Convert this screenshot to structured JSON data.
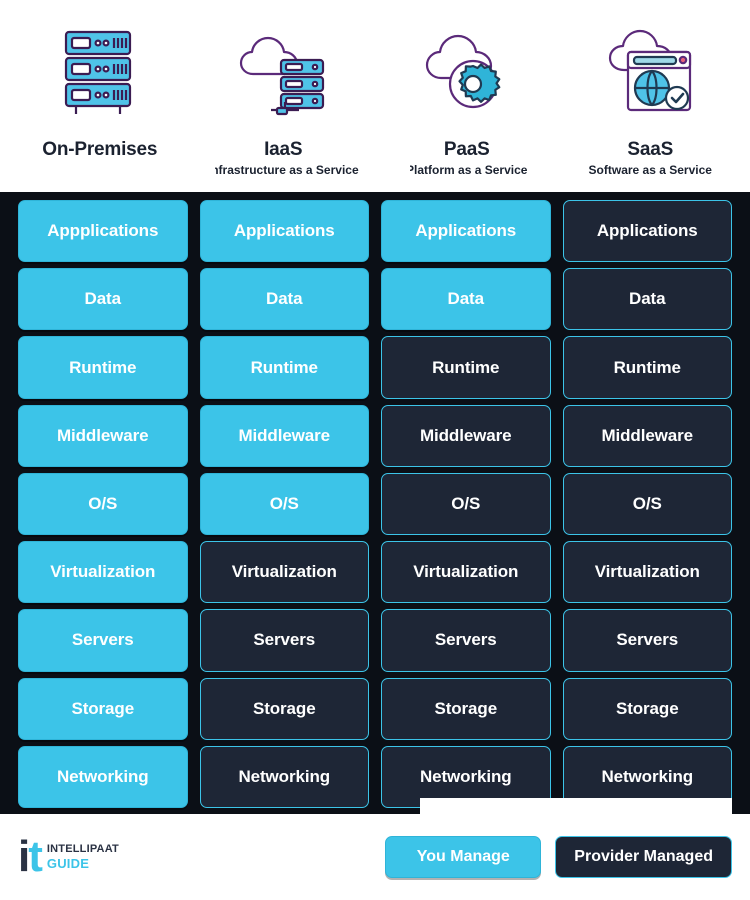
{
  "columns": [
    {
      "id": "on-premises",
      "title": "On-Premises",
      "subtitle": "",
      "icon": "server-rack-icon"
    },
    {
      "id": "iaas",
      "title": "IaaS",
      "subtitle": "Infrastructure as a Service",
      "icon": "cloud-server-icon"
    },
    {
      "id": "paas",
      "title": "PaaS",
      "subtitle": "Platform as a Service",
      "icon": "cloud-gear-icon"
    },
    {
      "id": "saas",
      "title": "SaaS",
      "subtitle": "Software as a Service",
      "icon": "cloud-browser-globe-icon"
    }
  ],
  "rows": [
    "Applications",
    "Data",
    "Runtime",
    "Middleware",
    "O/S",
    "Virtualization",
    "Servers",
    "Storage",
    "Networking"
  ],
  "cells": [
    [
      {
        "label": "Appplications",
        "managed": "you"
      },
      {
        "label": "Applications",
        "managed": "you"
      },
      {
        "label": "Applications",
        "managed": "you"
      },
      {
        "label": "Applications",
        "managed": "provider"
      }
    ],
    [
      {
        "label": "Data",
        "managed": "you"
      },
      {
        "label": "Data",
        "managed": "you"
      },
      {
        "label": "Data",
        "managed": "you"
      },
      {
        "label": "Data",
        "managed": "provider"
      }
    ],
    [
      {
        "label": "Runtime",
        "managed": "you"
      },
      {
        "label": "Runtime",
        "managed": "you"
      },
      {
        "label": "Runtime",
        "managed": "provider"
      },
      {
        "label": "Runtime",
        "managed": "provider"
      }
    ],
    [
      {
        "label": "Middleware",
        "managed": "you"
      },
      {
        "label": "Middleware",
        "managed": "you"
      },
      {
        "label": "Middleware",
        "managed": "provider"
      },
      {
        "label": "Middleware",
        "managed": "provider"
      }
    ],
    [
      {
        "label": "O/S",
        "managed": "you"
      },
      {
        "label": "O/S",
        "managed": "you"
      },
      {
        "label": "O/S",
        "managed": "provider"
      },
      {
        "label": "O/S",
        "managed": "provider"
      }
    ],
    [
      {
        "label": "Virtualization",
        "managed": "you"
      },
      {
        "label": "Virtualization",
        "managed": "provider"
      },
      {
        "label": "Virtualization",
        "managed": "provider"
      },
      {
        "label": "Virtualization",
        "managed": "provider"
      }
    ],
    [
      {
        "label": "Servers",
        "managed": "you"
      },
      {
        "label": "Servers",
        "managed": "provider"
      },
      {
        "label": "Servers",
        "managed": "provider"
      },
      {
        "label": "Servers",
        "managed": "provider"
      }
    ],
    [
      {
        "label": "Storage",
        "managed": "you"
      },
      {
        "label": "Storage",
        "managed": "provider"
      },
      {
        "label": "Storage",
        "managed": "provider"
      },
      {
        "label": "Storage",
        "managed": "provider"
      }
    ],
    [
      {
        "label": "Networking",
        "managed": "you"
      },
      {
        "label": "Networking",
        "managed": "provider"
      },
      {
        "label": "Networking",
        "managed": "provider"
      },
      {
        "label": "Networking",
        "managed": "provider"
      }
    ]
  ],
  "legend": {
    "you_manage": "You Manage",
    "provider_managed": "Provider Managed"
  },
  "logo": {
    "mark_primary": "i",
    "mark_accent": "t",
    "word_top": "INTELLIPAAT",
    "word_bottom": "GUIDE"
  },
  "colors": {
    "accent_cyan": "#3cc4e8",
    "dark_panel": "#1e2636",
    "background": "#0b0f16",
    "band_white": "#ffffff"
  }
}
